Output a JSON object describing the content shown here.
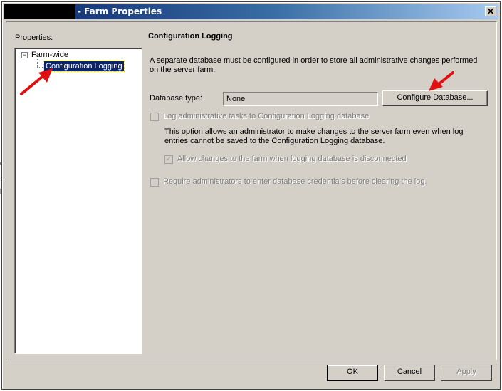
{
  "window": {
    "title": "- Farm Properties",
    "close_glyph": "✕"
  },
  "sidebar": {
    "label": "Properties:",
    "tree": {
      "root_label": "Farm-wide",
      "expander_glyph": "−",
      "child_label": "Configuration Logging"
    }
  },
  "panel": {
    "title": "Configuration Logging",
    "description": "A separate database must be configured in order to store all administrative changes performed on the server farm.",
    "db_type_label": "Database type:",
    "db_type_value": "None",
    "configure_button": "Configure Database...",
    "log_tasks_label": "Log administrative tasks to Configuration Logging database",
    "option_description": "This option allows an administrator to make changes to the server farm even when log entries cannot be saved to the Configuration Logging database.",
    "allow_changes_label": "Allow changes to the farm when logging database is disconnected",
    "allow_changes_checked": true,
    "require_credentials_label": "Require administrators to enter database credentials before clearing the log.",
    "checkmark_glyph": "✓"
  },
  "footer": {
    "ok": "OK",
    "cancel": "Cancel",
    "apply": "Apply"
  },
  "colors": {
    "titlebar_start": "#0a246a",
    "titlebar_end": "#a6caf0",
    "dialog_bg": "#d4d0c8",
    "selection": "#0a246a",
    "annotation_arrow": "#e01010"
  },
  "background_fragments": [
    "e",
    "«",
    "l"
  ]
}
